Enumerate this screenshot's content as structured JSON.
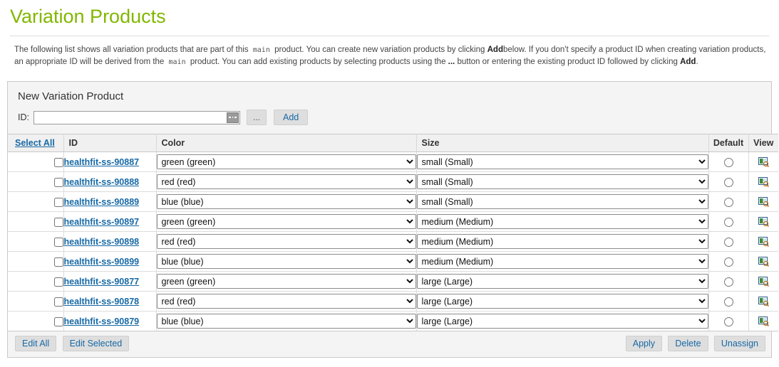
{
  "page": {
    "title": "Variation Products",
    "intro": {
      "part1": "The following list shows all variation products that are part of this",
      "token1": "main",
      "part2": "product. You can create new variation products by clicking",
      "bold1": "Add",
      "part3": "below. If you don't specify a product ID when creating variation products, an appropriate ID will be derived from the",
      "token2": "main",
      "part4": "product. You can add existing products by selecting products using the",
      "bold2": "...",
      "part5": "button or entering the existing product ID followed by clicking",
      "bold3": "Add",
      "part6": "."
    }
  },
  "new_variation": {
    "header": "New Variation Product",
    "id_label": "ID:",
    "id_value": "",
    "id_placeholder": "",
    "picker_icon": "field-picker-icon",
    "browse_label": "...",
    "add_label": "Add"
  },
  "table": {
    "columns": {
      "select_all": "Select All",
      "id": "ID",
      "color": "Color",
      "size": "Size",
      "default": "Default",
      "view": "View"
    },
    "rows": [
      {
        "id": "healthfit-ss-90887",
        "color": "green (green)",
        "size": "small (Small)",
        "checked": false,
        "is_default": false
      },
      {
        "id": "healthfit-ss-90888",
        "color": "red (red)",
        "size": "small (Small)",
        "checked": false,
        "is_default": false
      },
      {
        "id": "healthfit-ss-90889",
        "color": "blue (blue)",
        "size": "small (Small)",
        "checked": false,
        "is_default": false
      },
      {
        "id": "healthfit-ss-90897",
        "color": "green (green)",
        "size": "medium (Medium)",
        "checked": false,
        "is_default": false
      },
      {
        "id": "healthfit-ss-90898",
        "color": "red (red)",
        "size": "medium (Medium)",
        "checked": false,
        "is_default": false
      },
      {
        "id": "healthfit-ss-90899",
        "color": "blue (blue)",
        "size": "medium (Medium)",
        "checked": false,
        "is_default": false
      },
      {
        "id": "healthfit-ss-90877",
        "color": "green (green)",
        "size": "large (Large)",
        "checked": false,
        "is_default": false
      },
      {
        "id": "healthfit-ss-90878",
        "color": "red (red)",
        "size": "large (Large)",
        "checked": false,
        "is_default": false
      },
      {
        "id": "healthfit-ss-90879",
        "color": "blue (blue)",
        "size": "large (Large)",
        "checked": false,
        "is_default": false
      }
    ],
    "color_options": [
      "green (green)",
      "red (red)",
      "blue (blue)"
    ],
    "size_options": [
      "small (Small)",
      "medium (Medium)",
      "large (Large)"
    ],
    "view_icon": "view-document-magnifier-icon"
  },
  "footer": {
    "edit_all": "Edit All",
    "edit_selected": "Edit Selected",
    "apply": "Apply",
    "delete": "Delete",
    "unassign": "Unassign"
  },
  "colors": {
    "title_green": "#82b700",
    "link_blue": "#1769a5",
    "panel_bg": "#f4f4f4",
    "header_bg": "#f0f0f0",
    "border": "#c9c9c9"
  }
}
